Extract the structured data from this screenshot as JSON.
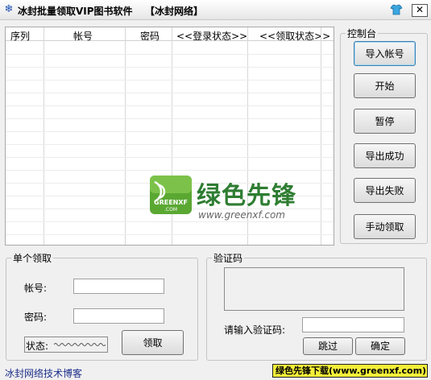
{
  "window": {
    "title": "冰封批量领取VIP图书软件",
    "title_tag": "【冰封网络】",
    "close_glyph": "✕"
  },
  "grid": {
    "columns": [
      "序列",
      "帐号",
      "密码",
      "<<登录状态>>",
      "<<领取状态>>"
    ]
  },
  "watermark": {
    "brand_cn": "绿色先锋",
    "logo_text": "GREENXF\n.COM",
    "url": "www.greenxf.com"
  },
  "control_panel": {
    "legend": "控制台",
    "buttons": {
      "import": "导入帐号",
      "start": "开始",
      "pause": "暂停",
      "export_success": "导出成功",
      "export_fail": "导出失败",
      "manual": "手动领取"
    }
  },
  "single": {
    "legend": "单个领取",
    "account_label": "帐号:",
    "account_value": "",
    "password_label": "密码:",
    "password_value": "",
    "status_label": "状态:",
    "claim_button": "领取"
  },
  "captcha": {
    "legend": "验证码",
    "input_label": "请输入验证码:",
    "input_value": "",
    "skip_button": "跳过",
    "confirm_button": "确定"
  },
  "footer": {
    "blog_link": "冰封网络技术博客",
    "banner": "绿色先锋下载(www.greenxf.com)"
  },
  "colors": {
    "brand_green": "#2e7d32",
    "banner_bg": "#f4ef39",
    "link": "#1c2f8a"
  }
}
